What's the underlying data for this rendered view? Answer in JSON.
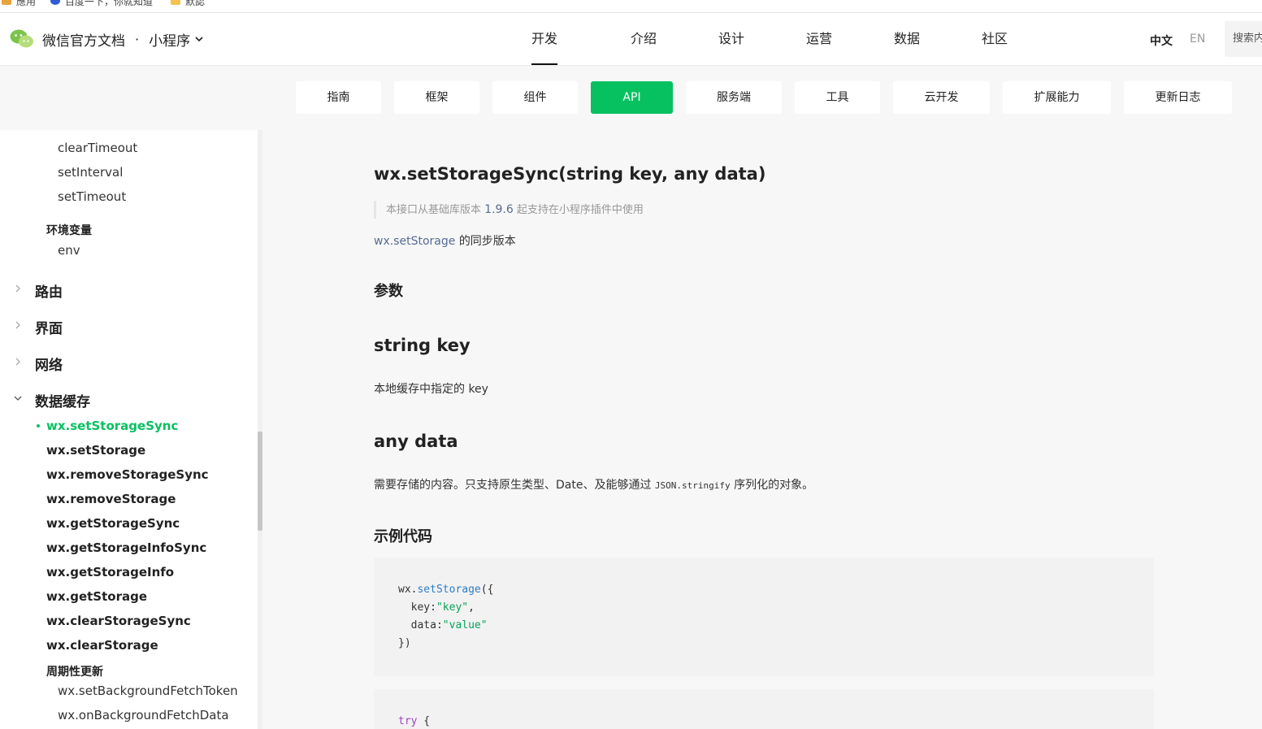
{
  "bookmarks": [
    {
      "label": "應用",
      "icon": "apps-grid-icon"
    },
    {
      "label": "百度一下，你就知道",
      "icon": "baidu-paw-icon"
    },
    {
      "label": "默認",
      "icon": "folder-icon"
    }
  ],
  "header": {
    "site_title": "微信官方文档",
    "separator": "·",
    "product": "小程序",
    "nav": [
      "开发",
      "介绍",
      "设计",
      "运营",
      "数据",
      "社区"
    ],
    "active_nav": "开发",
    "lang_zh": "中文",
    "lang_en": "EN",
    "search_placeholder": "搜索内容"
  },
  "tabs": [
    "指南",
    "框架",
    "组件",
    "API",
    "服务端",
    "工具",
    "云开发",
    "扩展能力",
    "更新日志"
  ],
  "active_tab": "API",
  "sidebar": {
    "timers": [
      "clearTimeout",
      "setInterval",
      "setTimeout"
    ],
    "env_group": "环境变量",
    "env_item": "env",
    "collapsed_sections": [
      "路由",
      "界面",
      "网络"
    ],
    "expanded_section": "数据缓存",
    "storage_items": [
      "wx.setStorageSync",
      "wx.setStorage",
      "wx.removeStorageSync",
      "wx.removeStorage",
      "wx.getStorageSync",
      "wx.getStorageInfoSync",
      "wx.getStorageInfo",
      "wx.getStorage",
      "wx.clearStorageSync",
      "wx.clearStorage"
    ],
    "active_item": "wx.setStorageSync",
    "periodic_group": "周期性更新",
    "periodic_items": [
      "wx.setBackgroundFetchToken",
      "wx.onBackgroundFetchData"
    ]
  },
  "content": {
    "title": "wx.setStorageSync(string key, any data)",
    "note_prefix": "本接口从基础库版本",
    "note_version": "1.9.6",
    "note_suffix": "起支持在小程序插件中使用",
    "desc_link": "wx.setStorage",
    "desc_text": "的同步版本",
    "params_heading": "参数",
    "param1_name": "string key",
    "param1_desc": "本地缓存中指定的 key",
    "param2_name": "any data",
    "param2_desc_a": "需要存储的内容。只支持原生类型、Date、及能够通过",
    "param2_desc_code": "JSON.stringify",
    "param2_desc_b": "序列化的对象。",
    "example_heading": "示例代码",
    "code1": {
      "obj": "wx.",
      "fn": "setStorage",
      "open": "({",
      "key_label": "key:",
      "key_value": "\"key\"",
      "comma": ",",
      "data_label": "data:",
      "data_value": "\"value\"",
      "close": "})"
    },
    "code2": {
      "kw": "try",
      "brace": " {"
    }
  },
  "colors": {
    "accent": "#07c160",
    "link": "#576b95",
    "background": "#f7f7f7"
  }
}
